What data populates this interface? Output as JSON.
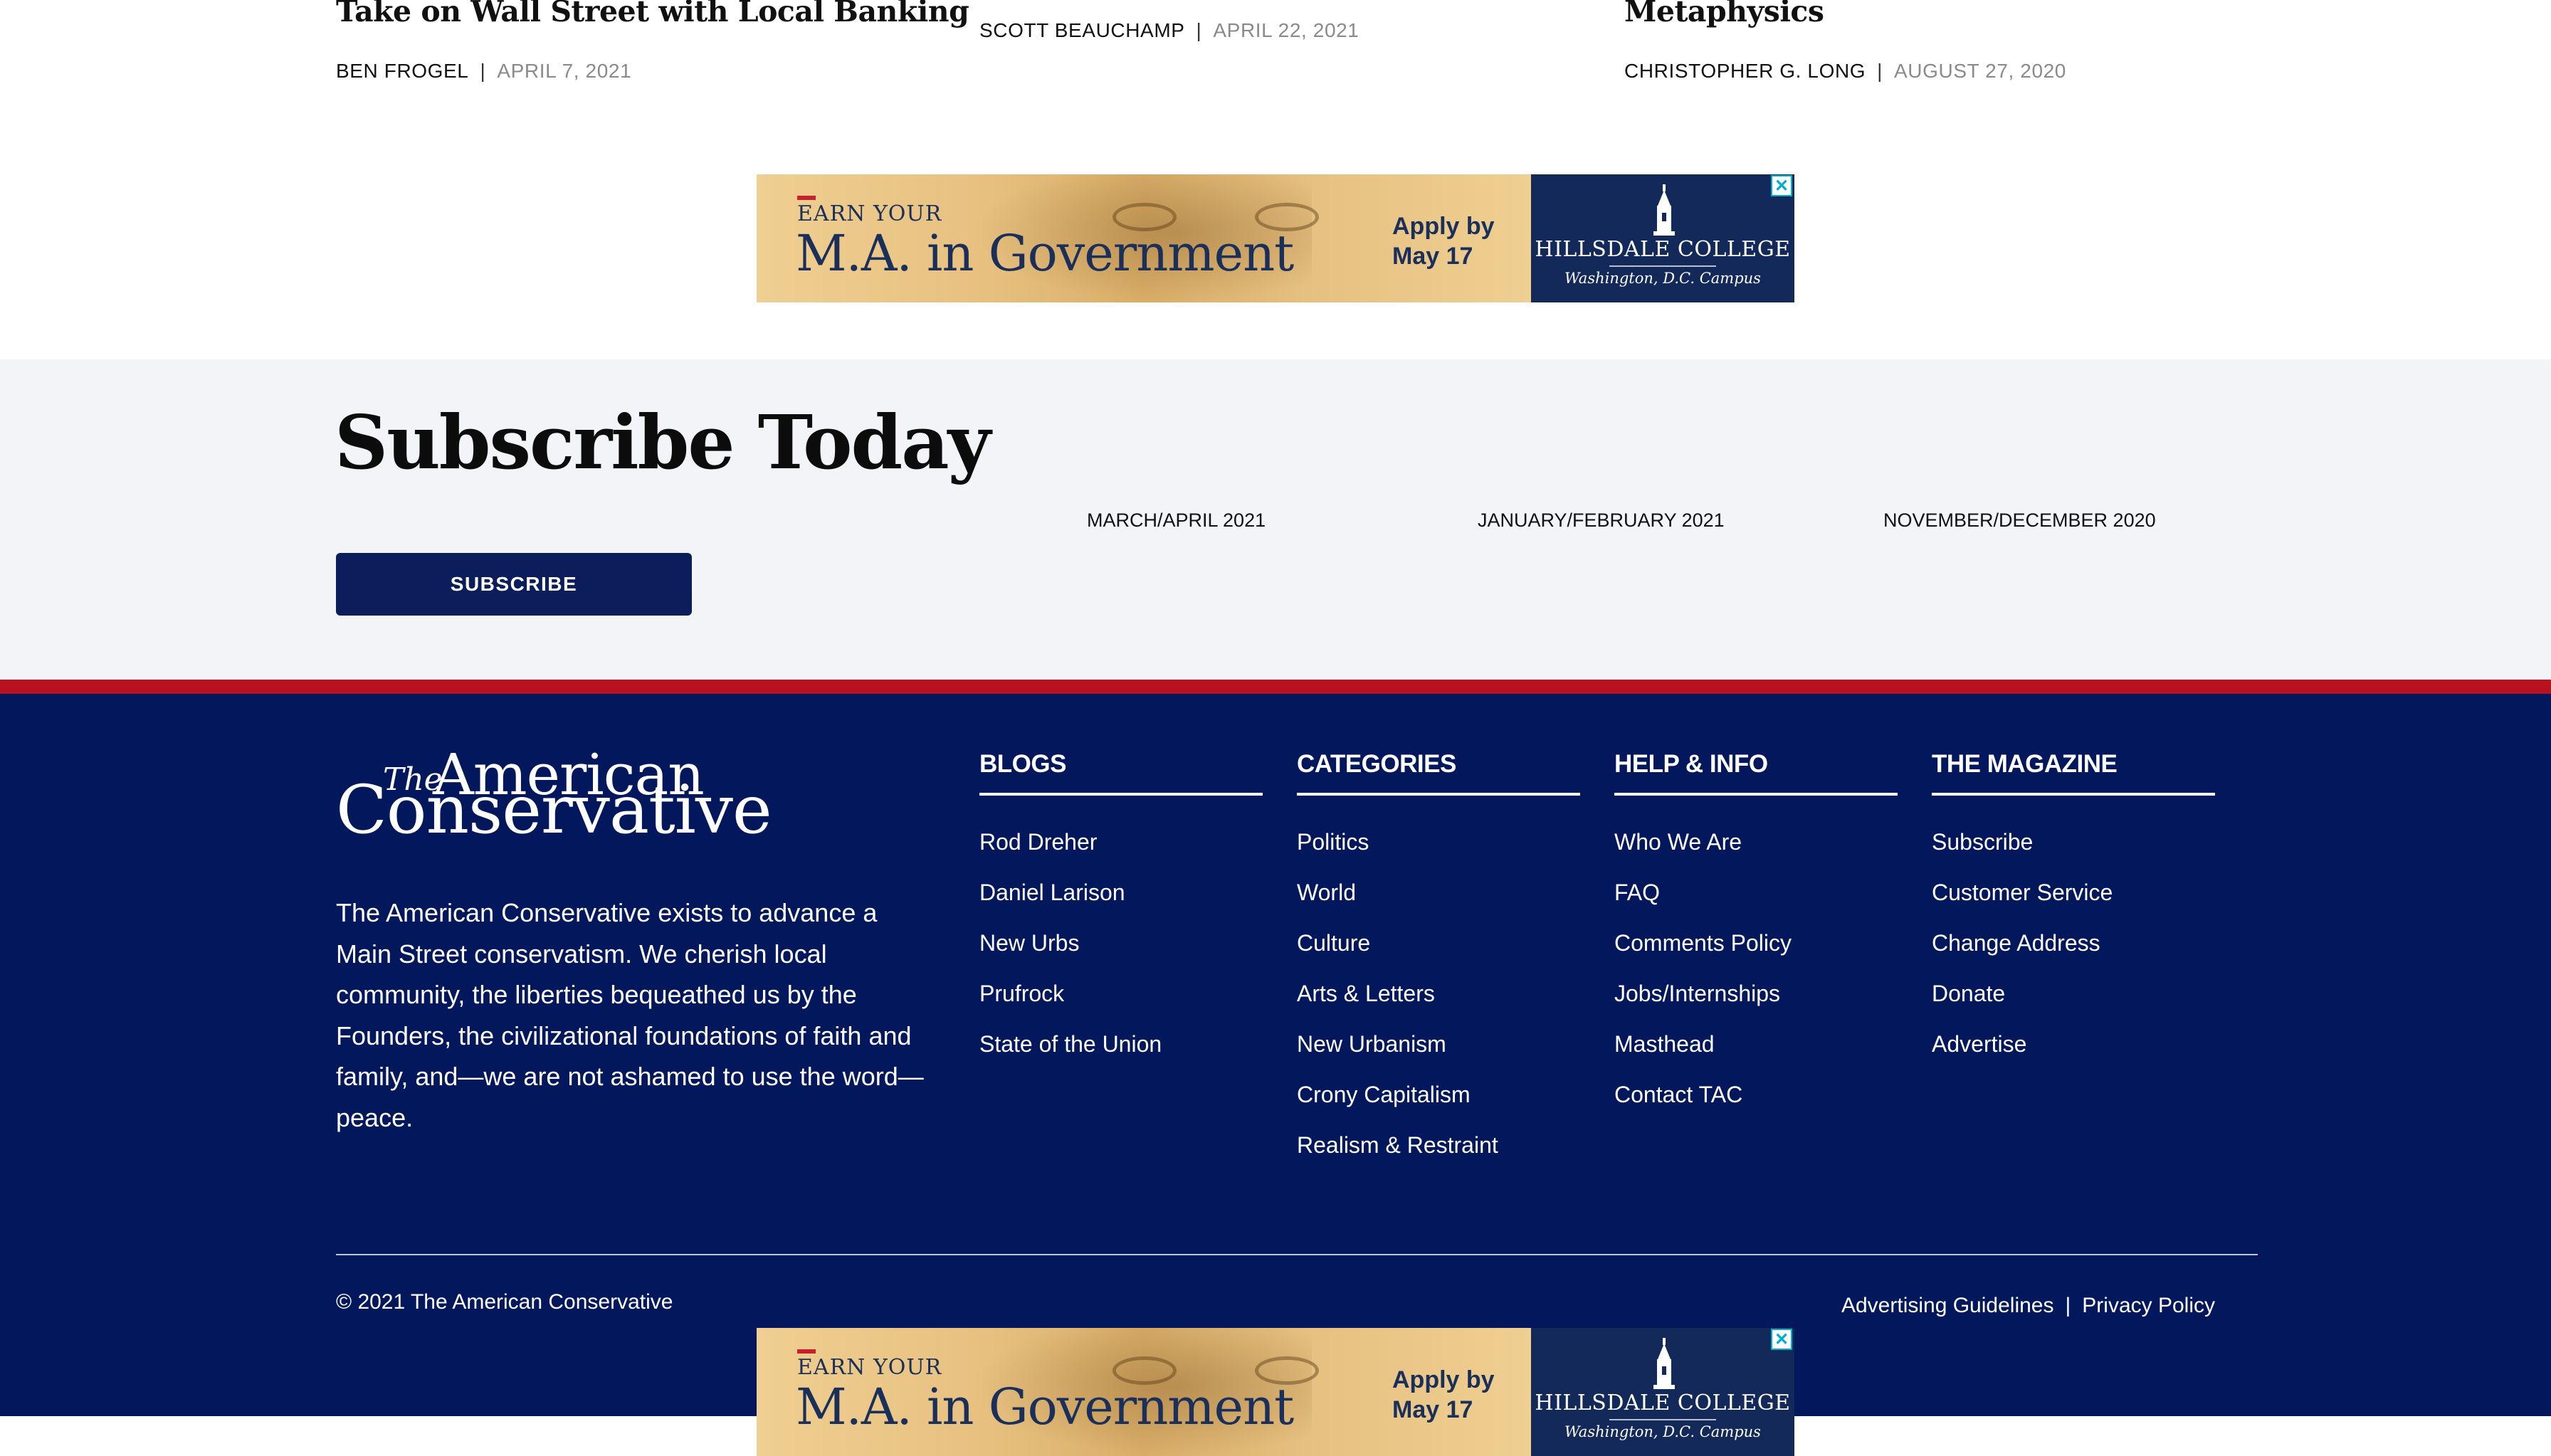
{
  "articles": [
    {
      "title": "Take on Wall Street with Local Banking",
      "author": "BEN FROGEL",
      "date": "APRIL 7, 2021"
    },
    {
      "title": "",
      "author": "SCOTT BEAUCHAMP",
      "date": "APRIL 22, 2021"
    },
    {
      "title": "Metaphysics",
      "author": "CHRISTOPHER G. LONG",
      "date": "AUGUST 27, 2020"
    }
  ],
  "ad": {
    "earn": "EARN YOUR",
    "headline": "M.A. in Government",
    "apply": "Apply by\nMay 17",
    "college": "HILLSDALE COLLEGE",
    "campus": "Washington, D.C. Campus",
    "close_glyph": "✕"
  },
  "subscribe": {
    "title": "Subscribe Today",
    "button": "SUBSCRIBE",
    "issues": [
      "MARCH/APRIL 2021",
      "JANUARY/FEBRUARY 2021",
      "NOVEMBER/DECEMBER 2020"
    ]
  },
  "footer": {
    "logo": {
      "the": "The",
      "american": "American",
      "conservative": "Conservative"
    },
    "mission": "The American Conservative exists to advance a Main Street conservatism. We cherish local community, the liberties bequeathed us by the Founders, the civilizational foundations of faith and family, and—we are not ashamed to use the word—peace.",
    "columns": [
      {
        "heading": "BLOGS",
        "items": [
          "Rod Dreher",
          "Daniel Larison",
          "New Urbs",
          "Prufrock",
          "State of the Union"
        ]
      },
      {
        "heading": "CATEGORIES",
        "items": [
          "Politics",
          "World",
          "Culture",
          "Arts & Letters",
          "New Urbanism",
          "Crony Capitalism",
          "Realism & Restraint"
        ]
      },
      {
        "heading": "HELP & INFO",
        "items": [
          "Who We Are",
          "FAQ",
          "Comments Policy",
          "Jobs/Internships",
          "Masthead",
          "Contact TAC"
        ]
      },
      {
        "heading": "THE MAGAZINE",
        "items": [
          "Subscribe",
          "Customer Service",
          "Change Address",
          "Donate",
          "Advertise"
        ]
      }
    ],
    "copyright": "© 2021 The American Conservative",
    "legal": {
      "advertising": "Advertising Guidelines",
      "separator": "|",
      "privacy": "Privacy Policy"
    }
  },
  "colors": {
    "navy": "#03185c",
    "red_bar": "#b8111f",
    "subscribe_bg": "#f3f4f8",
    "button": "#0b1e5b"
  }
}
